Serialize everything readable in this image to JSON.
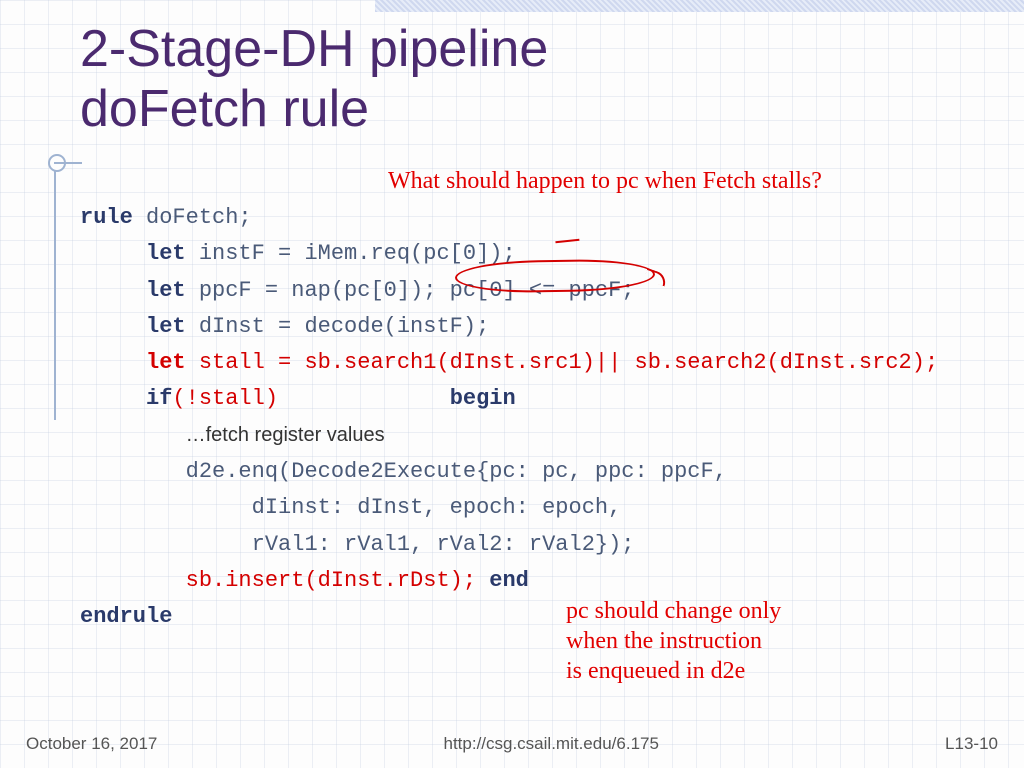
{
  "title_line1": "2-Stage-DH pipeline",
  "title_line2": "doFetch rule",
  "annotation_top": "What should happen to pc when Fetch stalls?",
  "annotation_bottom_l1": "pc should change only",
  "annotation_bottom_l2": "when the instruction",
  "annotation_bottom_l3": "is enqueued in d2e",
  "code": {
    "kw_rule": "rule",
    "rule_name": " doFetch;",
    "kw_let1": "let",
    "line_instf": " instF = iMem.req(pc[0]);",
    "kw_let2": "let",
    "line_ppcf_a": " ppcF = nap(pc[0]); ",
    "line_ppcf_b": "pc[0] <= ppcF;",
    "kw_let3": "let",
    "line_dinst": " dInst = decode(instF);",
    "kw_let4_red": "let",
    "line_stall": " stall = sb.search1(dInst.src1)|| sb.search2(dInst.src2);",
    "kw_if": "if",
    "line_if": "(!stall)",
    "kw_begin": "begin",
    "line_fetch": "…fetch register values",
    "line_enq1": "d2e.enq(Decode2Execute{pc: pc, ppc: ppcF,",
    "line_enq2": "dIinst: dInst, epoch: epoch,",
    "line_enq3": "rVal1: rVal1, rVal2: rVal2});",
    "line_sb": "sb.insert(dInst.rDst);",
    "kw_end": " end",
    "kw_endrule": "endrule"
  },
  "footer": {
    "date": "October 16, 2017",
    "url": "http://csg.csail.mit.edu/6.175",
    "page": "L13-10"
  }
}
